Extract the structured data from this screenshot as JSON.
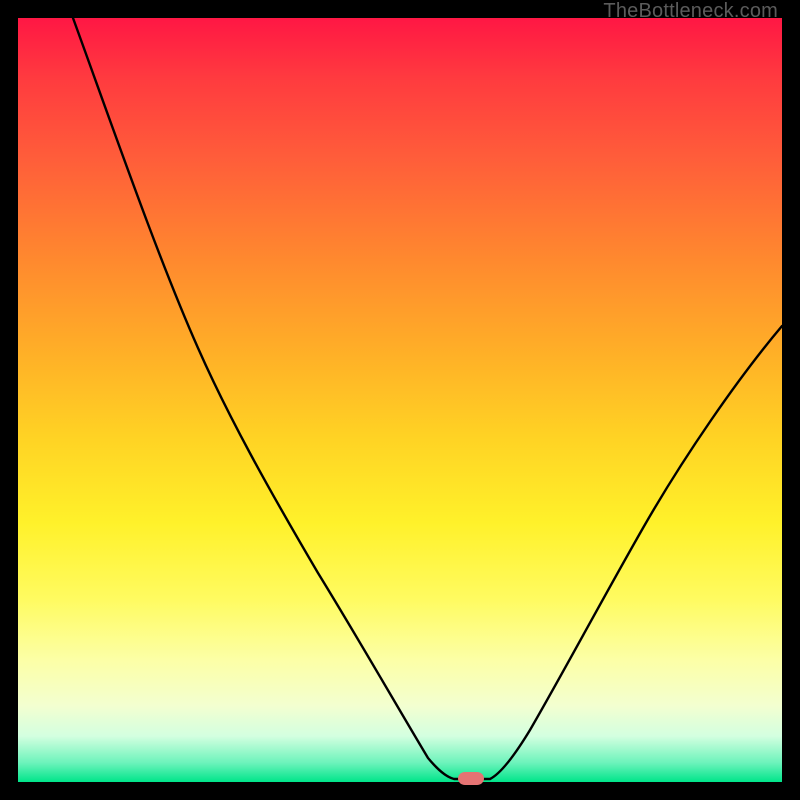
{
  "watermark": "TheBottleneck.com",
  "colors": {
    "curve": "#000000",
    "marker": "#e57373",
    "gradient_top": "#ff1744",
    "gradient_bottom": "#00e58a",
    "frame": "#000000"
  },
  "chart_data": {
    "type": "line",
    "title": "",
    "xlabel": "",
    "ylabel": "",
    "xlim": [
      0,
      100
    ],
    "ylim": [
      0,
      100
    ],
    "x": [
      0,
      5,
      10,
      15,
      20,
      25,
      30,
      35,
      40,
      45,
      50,
      53,
      55,
      57,
      58,
      60,
      62,
      65,
      70,
      75,
      80,
      85,
      90,
      95,
      100
    ],
    "values": [
      100,
      93,
      86,
      78,
      73,
      66,
      58,
      50,
      41,
      32,
      22,
      14,
      8,
      3,
      1,
      0,
      0,
      3,
      12,
      23,
      33,
      42,
      49,
      55,
      60
    ],
    "note": "Values approximate vertical position of the black curve as read against the gradient background; 0 = bottom (green), 100 = top (red). Minimum occurs near x ≈ 58–62 (marker).",
    "min_marker": {
      "x": 59,
      "y": 0
    }
  }
}
